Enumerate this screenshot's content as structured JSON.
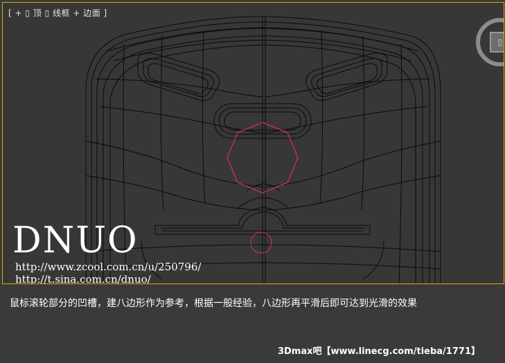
{
  "viewport": {
    "label": "[ + ▯ 顶 ▯ 线框 + 边面 ]",
    "view_cube_face": "▯",
    "wire_color": "#0a0a0a",
    "highlight_color": "#e0287a",
    "border_color": "#d6b100"
  },
  "watermark": {
    "brand": "DNUO",
    "url1": "http://www.zcool.com.cn/u/250796/",
    "url2": "http://t.sina.com.cn/dnuo/"
  },
  "caption": "鼠标滚轮部分的凹槽，建八边形作为参考，根据一般经验，八边形再平滑后即可达到光滑的效果",
  "footer": "3Dmax吧【www.linecg.com/tieba/1771】"
}
